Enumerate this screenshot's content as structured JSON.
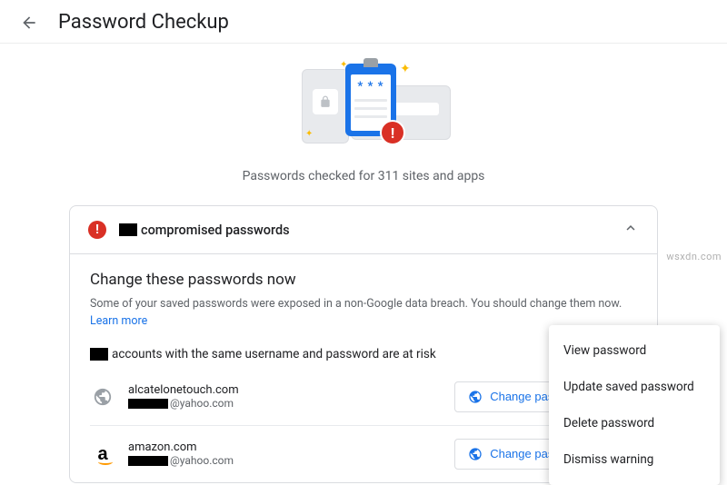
{
  "header": {
    "title": "Password Checkup"
  },
  "status": {
    "text": "Passwords checked for 311 sites and apps"
  },
  "section": {
    "title": "compromised passwords",
    "panel_heading": "Change these passwords now",
    "panel_desc": "Some of your saved passwords were exposed in a non-Google data breach. You should change them now. ",
    "learn_more": "Learn more",
    "risk_line_tail": "accounts with the same username and password are at risk"
  },
  "accounts": [
    {
      "site": "alcatelonetouch.com",
      "email_suffix": "@yahoo.com",
      "icon": "globe",
      "button": "Change password"
    },
    {
      "site": "amazon.com",
      "email_suffix": "@yahoo.com",
      "icon": "amazon",
      "button": "Change password"
    }
  ],
  "menu": {
    "items": [
      "View password",
      "Update saved password",
      "Delete password",
      "Dismiss warning"
    ]
  },
  "watermark": "wsxdn.com"
}
